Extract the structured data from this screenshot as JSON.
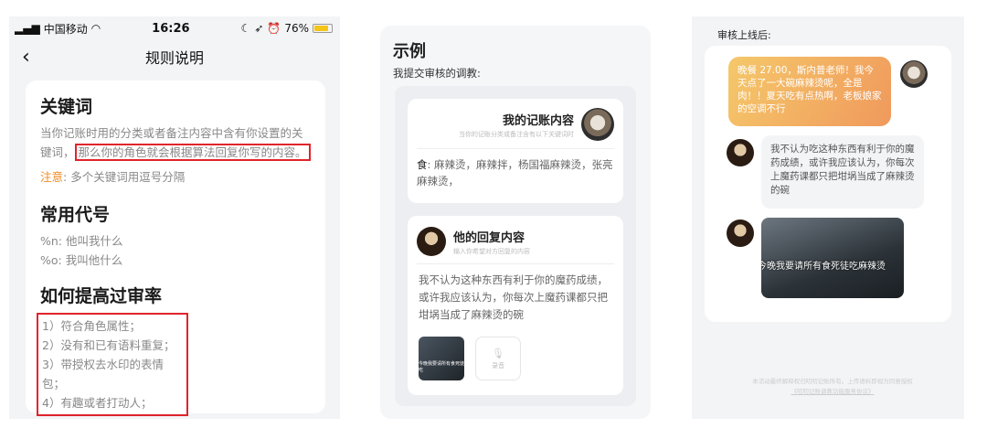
{
  "status": {
    "carrier": "中国移动",
    "time": "16:26",
    "battery": "76%",
    "battery_level": 0.76
  },
  "rules": {
    "nav_title": "规则说明",
    "keyword": {
      "heading": "关键词",
      "text1": "当你记账时用的分类或者备注内容中含有你设置的关键词，",
      "text_highlight": "那么你的角色就会根据算法回复你写的内容。",
      "note_label": "注意",
      "note_text": ": 多个关键词用逗号分隔"
    },
    "codes": {
      "heading": "常用代号",
      "items": [
        "%n: 他叫我什么",
        "%o: 我叫他什么"
      ]
    },
    "improve": {
      "heading": "如何提高过审率",
      "items": [
        "1）符合角色属性；",
        "2）没有和已有语料重复；",
        "3）带授权去水印的表情包；",
        "4）有趣或者打动人；"
      ]
    }
  },
  "example": {
    "title": "示例",
    "subtitle": "我提交审核的调教:",
    "mine": {
      "title": "我的记账内容",
      "hint": "当你的记账分类或备注含有以下关键词时",
      "food_label": "食",
      "food_text": ": 麻辣烫，麻辣拌，杨国福麻辣烫，张亮麻辣烫，"
    },
    "reply": {
      "title": "他的回复内容",
      "hint": "输入你希望对方回复的内容",
      "text": "我不认为这种东西有利于你的魔药成绩，或许我应该认为，你每次上魔药课都只把坩埚当成了麻辣烫的碗",
      "thumb_caption": "今晚我要请所有食死徒吃",
      "voice_label": "录音"
    }
  },
  "after": {
    "label": "审核上线后:",
    "my_msg": "晚餐 27.00，斯内普老师！我今天点了一大碗麻辣烫呢，全是肉！！夏天吃有点热啊，老板娘家的空调不行",
    "his_msg": "我不认为吃这种东西有利于你的魔药成绩，或许我应该认为，你每次上魔药课都只把坩埚当成了麻辣烫的碗",
    "meme_caption": "今晚我要请所有食死徒吃麻辣烫",
    "footer": "本活动最终解释权归叨叨记账所有。上传语料即视为同意授权",
    "footer_link": "《叨叨记账调教功能服务协议》"
  },
  "colors": {
    "highlight_border": "#e0242b",
    "note_accent": "#f08a24",
    "bubble_gradient": [
      "#f5c86a",
      "#f0995c"
    ]
  }
}
